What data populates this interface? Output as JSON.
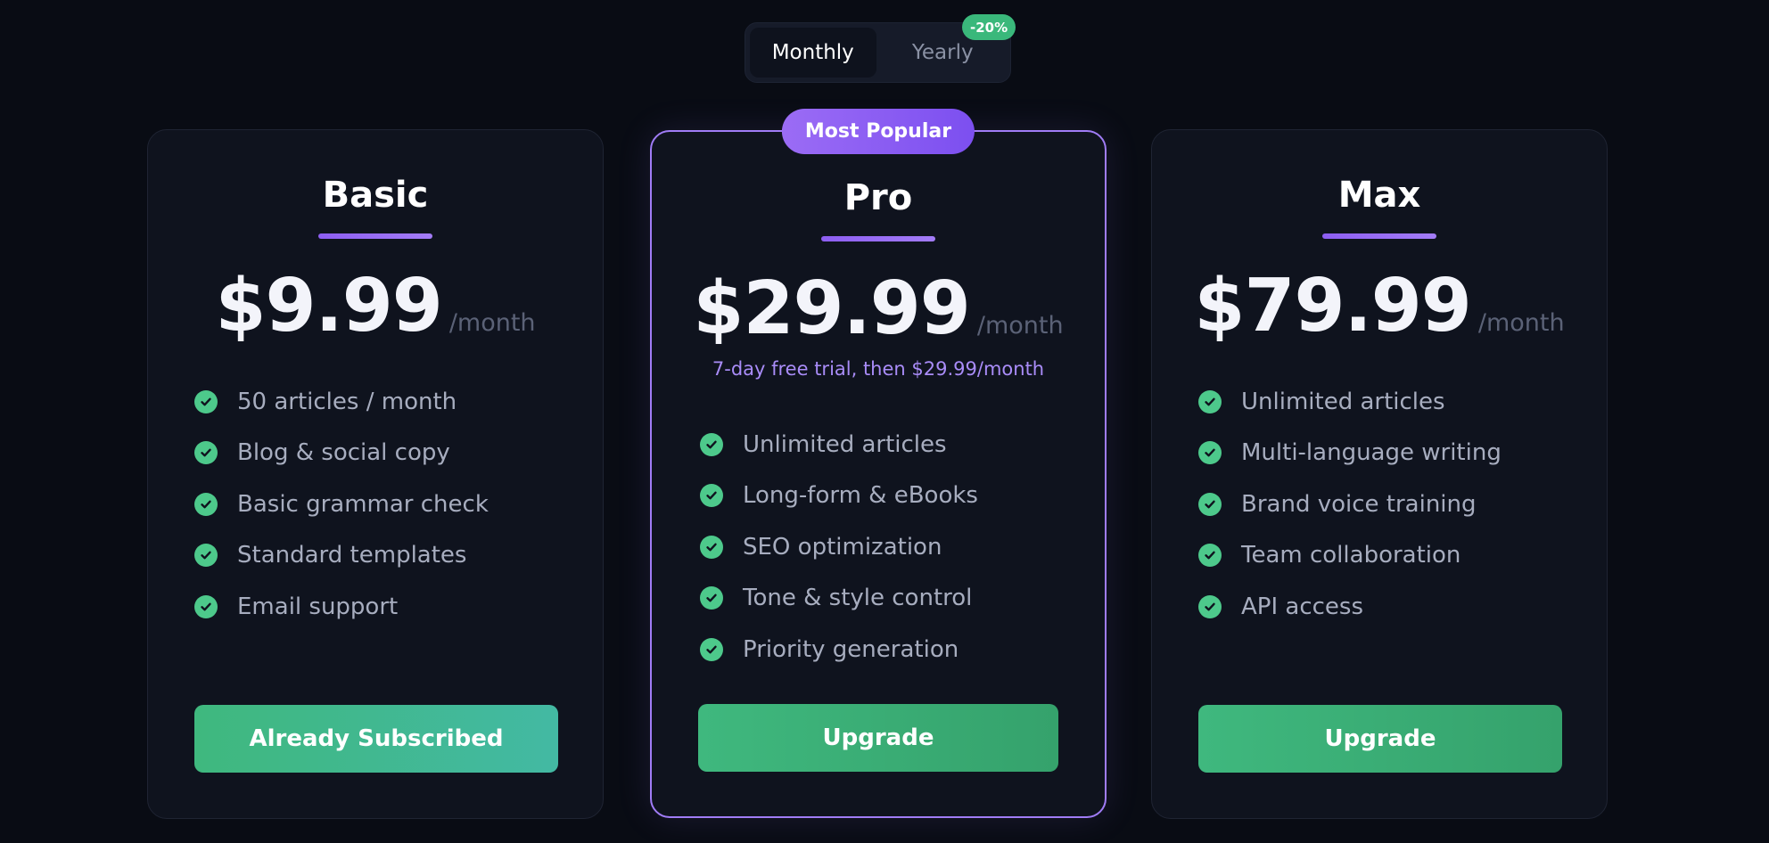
{
  "billing_toggle": {
    "monthly_label": "Monthly",
    "yearly_label": "Yearly",
    "yearly_discount": "-20%",
    "selected": "monthly"
  },
  "plans": [
    {
      "name": "Basic",
      "price": "$9.99",
      "period": "/month",
      "features": [
        "50 articles / month",
        "Blog & social copy",
        "Basic grammar check",
        "Standard templates",
        "Email support"
      ],
      "cta_label": "Already Subscribed"
    },
    {
      "name": "Pro",
      "badge": "Most Popular",
      "price": "$29.99",
      "period": "/month",
      "trial_note": "7-day free trial, then $29.99/month",
      "features": [
        "Unlimited articles",
        "Long-form & eBooks",
        "SEO optimization",
        "Tone & style control",
        "Priority generation"
      ],
      "cta_label": "Upgrade"
    },
    {
      "name": "Max",
      "price": "$79.99",
      "period": "/month",
      "features": [
        "Unlimited articles",
        "Multi-language writing",
        "Brand voice training",
        "Team collaboration",
        "API access"
      ],
      "cta_label": "Upgrade"
    }
  ],
  "icons": {
    "feature_check": "check-circle-icon"
  },
  "colors": {
    "background": "#090c14",
    "card": "#0f131e",
    "accent_purple": "#a07cf6",
    "accent_green": "#3fb87e",
    "check_green": "#4dc98b"
  }
}
